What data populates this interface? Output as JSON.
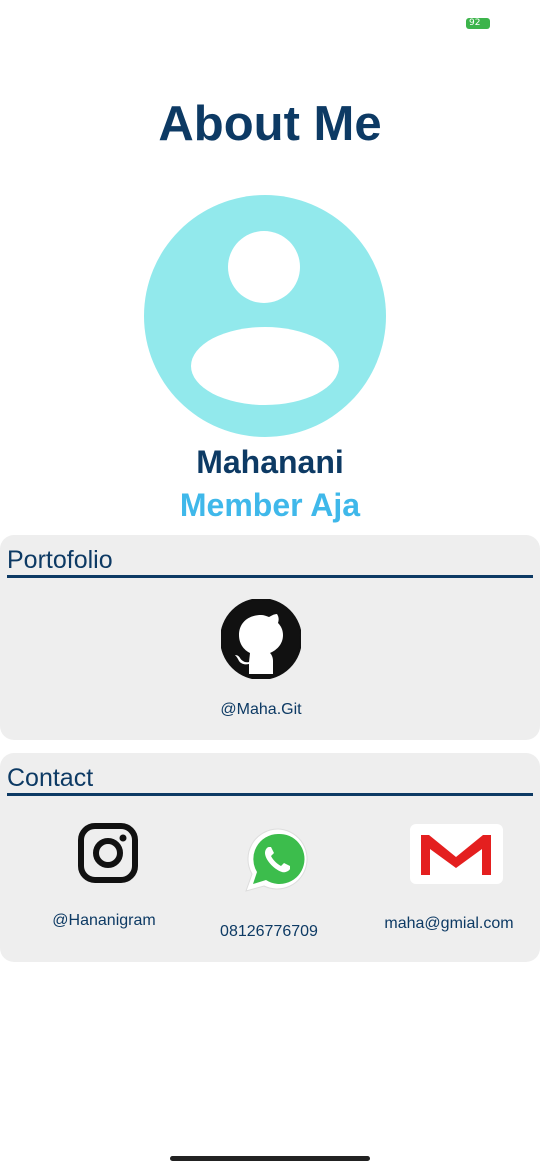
{
  "status_bar": {
    "battery_level": "92",
    "battery_color": "#3cb44b"
  },
  "header": {
    "title": "About Me"
  },
  "profile": {
    "avatar_icon": "person-silhouette-icon",
    "name": "Mahanani",
    "role": "Member Aja"
  },
  "portfolio": {
    "title": "Portofolio",
    "items": [
      {
        "icon": "github-icon",
        "label": "@Maha.Git"
      }
    ]
  },
  "contact": {
    "title": "Contact",
    "items": [
      {
        "icon": "instagram-icon",
        "label": "@Hananigram"
      },
      {
        "icon": "whatsapp-icon",
        "label": "08126776709"
      },
      {
        "icon": "gmail-icon",
        "label": "maha@gmial.com"
      }
    ]
  },
  "colors": {
    "primary": "#0d3a64",
    "accent": "#3fb8ea",
    "avatar_bg": "#92e9ec",
    "card_bg": "#eeeeee"
  }
}
